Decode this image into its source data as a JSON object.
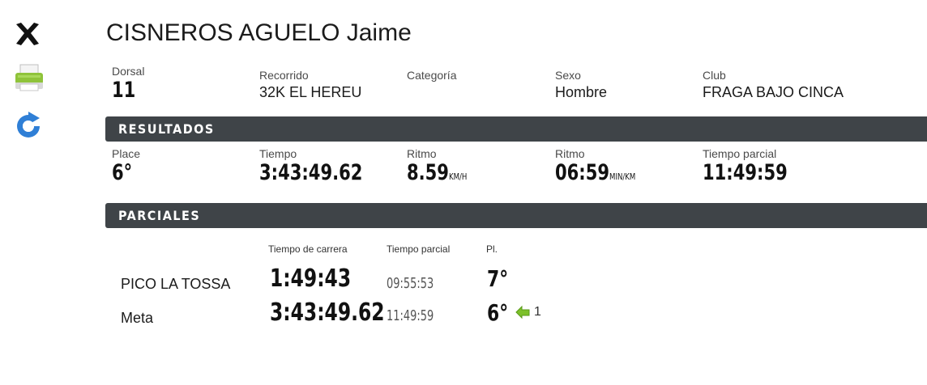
{
  "athlete": {
    "name": "CISNEROS AGUELO Jaime"
  },
  "info": {
    "dorsal_label": "Dorsal",
    "dorsal": "11",
    "route_label": "Recorrido",
    "route": "32K EL HEREU",
    "category_label": "Categoría",
    "category": "",
    "sex_label": "Sexo",
    "sex": "Hombre",
    "club_label": "Club",
    "club": "FRAGA BAJO CINCA"
  },
  "results": {
    "heading": "RESULTADOS",
    "place_label": "Place",
    "place": "6°",
    "time_label": "Tiempo",
    "time": "3:43:49.62",
    "pace_label": "Ritmo",
    "pace_speed": "8.59",
    "pace_speed_unit": "KM/H",
    "pace2_label": "Ritmo",
    "pace_minkm": "06:59",
    "pace_minkm_unit": "MIN/KM",
    "partial_label": "Tiempo parcial",
    "partial": "11:49:59"
  },
  "splits": {
    "heading": "PARCIALES",
    "col_race_time": "Tiempo de carrera",
    "col_partial": "Tiempo parcial",
    "col_pl": "Pl.",
    "rows": [
      {
        "name": "PICO LA TOSSA",
        "race_time": "1:49:43",
        "partial": "09:55:53",
        "pl": "7°",
        "gain": ""
      },
      {
        "name": "Meta",
        "race_time": "3:43:49.62",
        "partial": "11:49:59",
        "pl": "6°",
        "gain": "1"
      }
    ]
  },
  "icons": [
    "close-icon",
    "print-icon",
    "refresh-icon",
    "position-up-icon"
  ],
  "colors": {
    "bar": "#3f4448",
    "refresh": "#2f7fd6",
    "gain": "#7cc02a"
  }
}
